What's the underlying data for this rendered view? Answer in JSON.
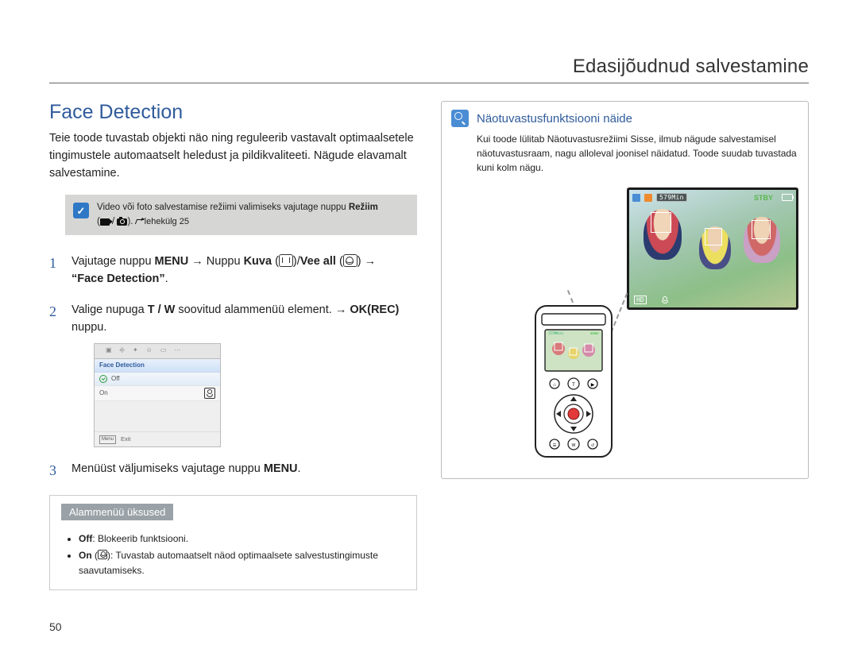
{
  "chapter_title": "Edasijõudnud salvestamine",
  "section_title": "Face Detection",
  "intro": "Teie toode tuvastab objekti näo ning reguleerib vastavalt optimaalsetele tingimustele automaatselt heledust ja pildikvaliteeti. Nägude elavamalt salvestamine.",
  "note": {
    "pre": "Video või foto salvestamise režiimi valimiseks vajutage nuppu ",
    "mode_word": "Režiim",
    "page_word": "lehekülg 25"
  },
  "steps": {
    "s1": {
      "num": "1",
      "a": "Vajutage nuppu ",
      "menu": "MENU",
      "b": " → Nuppu ",
      "kuva": "Kuva",
      "c": "/",
      "vee": "Vee all",
      "d": " → ",
      "face": "“Face Detection”",
      "e": "."
    },
    "s2": {
      "num": "2",
      "a": "Valige nupuga ",
      "tw": "T / W",
      "b": " soovitud alammenüü element. → ",
      "ok": "OK(REC)",
      "c": " nuppu."
    },
    "s3": {
      "num": "3",
      "a": "Menüüst väljumiseks vajutage nuppu ",
      "menu": "MENU",
      "b": "."
    }
  },
  "menu_shot": {
    "title": "Face Detection",
    "off": "Off",
    "on": "On",
    "exit_btn": "Menu",
    "exit": "Exit"
  },
  "submenu": {
    "title": "Alammenüü üksused",
    "off_label": "Off",
    "off_text": ": Blokeerib funktsiooni.",
    "on_label": "On",
    "on_text": ": Tuvastab automaatselt näod optimaalsete salvestustingimuste saavutamiseks."
  },
  "right": {
    "title": "Näotuvastusfunktsiooni näide",
    "body": "Kui toode lülitab Näotuvastusrežiimi Sisse, ilmub nägude salvestamisel näotuvastusraam, nagu alloleval joonisel näidatud. Toode suudab tuvastada kuni kolm nägu.",
    "osd": {
      "min": "579Min",
      "stby": "STBY",
      "hd": "HD"
    }
  },
  "page_number": "50"
}
